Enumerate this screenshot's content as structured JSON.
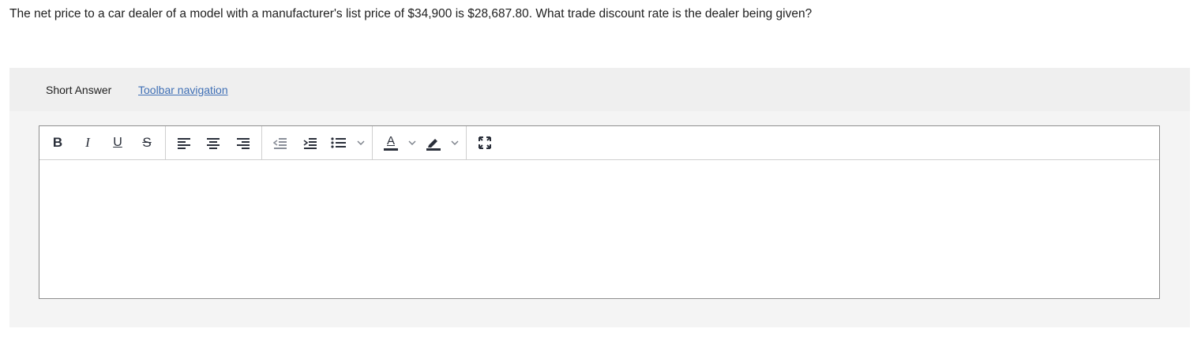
{
  "question": {
    "text": "The net price to a car dealer of a model with a manufacturer's list price of $34,900 is $28,687.80. What trade discount rate is the dealer being given?"
  },
  "answer_panel": {
    "type_label": "Short Answer",
    "toolbar_nav_label": "Toolbar navigation"
  },
  "toolbar": {
    "bold": "B",
    "italic": "I",
    "underline": "U",
    "strikethrough": "S",
    "text_color_letter": "A",
    "icons": [
      "bold-icon",
      "italic-icon",
      "underline-icon",
      "strikethrough-icon",
      "align-left-icon",
      "align-center-icon",
      "align-right-icon",
      "outdent-icon",
      "indent-icon",
      "bullet-list-icon",
      "chevron-down-icon",
      "text-color-icon",
      "highlight-icon",
      "fullscreen-icon"
    ]
  },
  "editor": {
    "value": ""
  },
  "colors": {
    "link": "#3f6fb5",
    "panel_bg": "#f4f4f4",
    "icon": "#2a2f3a"
  }
}
